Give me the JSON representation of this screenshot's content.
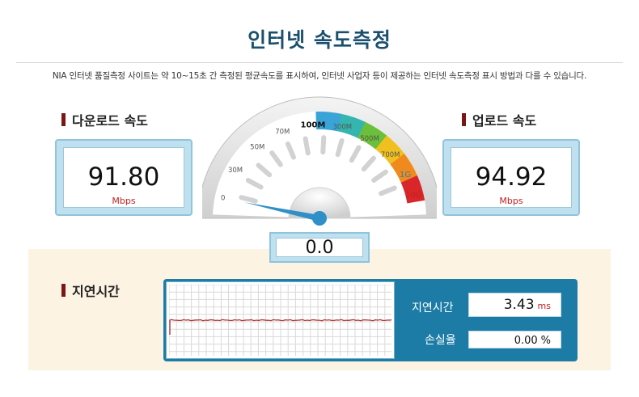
{
  "page": {
    "title": "인터넷 속도측정",
    "notice": "NIA 인터넷 품질측정 사이트는 약 10~15초 간 측정된 평균속도를 표시하여, 인터넷 사업자 등이 제공하는 인터넷 속도측정 표시 방법과 다를 수 있습니다."
  },
  "download": {
    "label": "다운로드 속도",
    "value": "91.80",
    "unit": "Mbps"
  },
  "upload": {
    "label": "업로드 속도",
    "value": "94.92",
    "unit": "Mbps"
  },
  "gauge": {
    "ticks": [
      "0",
      "30M",
      "50M",
      "70M",
      "100M",
      "300M",
      "500M",
      "700M",
      "1G",
      "10G"
    ],
    "readout": "0.0",
    "needle_value": 0.0,
    "colors": [
      "#3aa3d8",
      "#35b5b0",
      "#6cbf3a",
      "#f0c020",
      "#f08a1c",
      "#d8262a"
    ]
  },
  "latency": {
    "section_label": "지연시간",
    "latency_label": "지연시간",
    "latency_value": "3.43",
    "latency_unit": "ms",
    "loss_label": "손실율",
    "loss_value": "0.00",
    "loss_unit": "%",
    "graph_color": "#b03030"
  }
}
